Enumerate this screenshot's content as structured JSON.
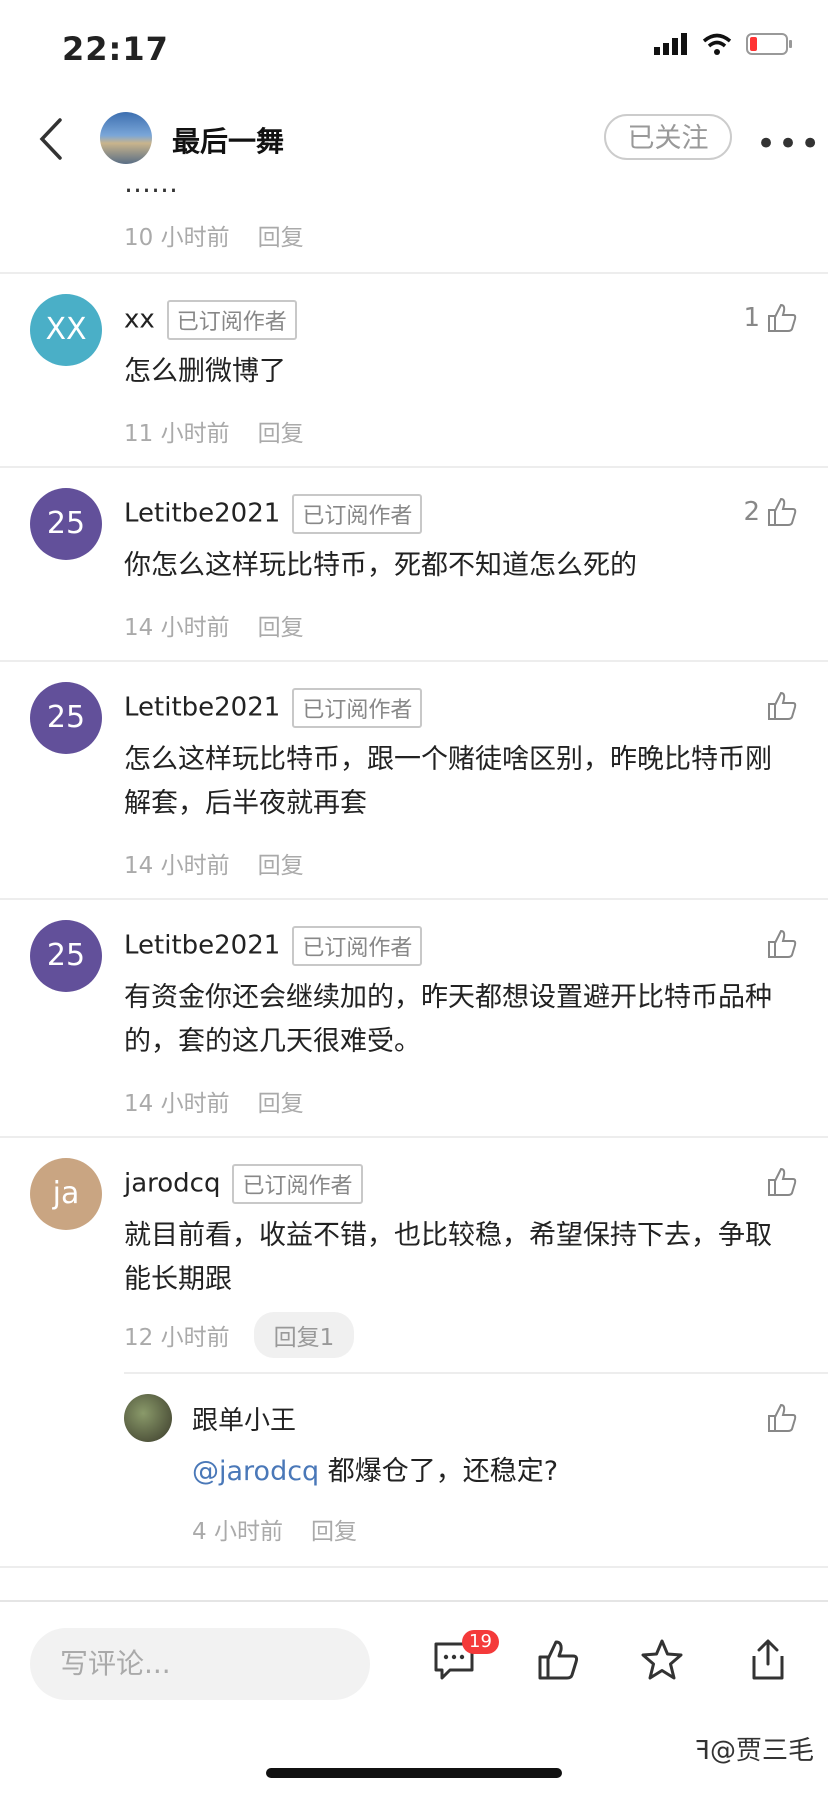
{
  "status": {
    "time": "22:17"
  },
  "nav": {
    "title": "最后一舞",
    "follow_label": "已关注",
    "more": "•••"
  },
  "partial": {
    "time": "10 小时前",
    "reply": "回复"
  },
  "comments": [
    {
      "avatar": "XX",
      "avatar_color": "#4aafc7",
      "name": "xx",
      "badge": "已订阅作者",
      "likes": "1",
      "text": "怎么删微博了",
      "time": "11 小时前",
      "reply": "回复"
    },
    {
      "avatar": "25",
      "avatar_color": "#62509a",
      "name": "Letitbe2021",
      "badge": "已订阅作者",
      "likes": "2",
      "text": "你怎么这样玩比特币，死都不知道怎么死的",
      "time": "14 小时前",
      "reply": "回复"
    },
    {
      "avatar": "25",
      "avatar_color": "#62509a",
      "name": "Letitbe2021",
      "badge": "已订阅作者",
      "text": "怎么这样玩比特币，跟一个赌徒啥区别，昨晚比特币刚解套，后半夜就再套",
      "time": "14 小时前",
      "reply": "回复"
    },
    {
      "avatar": "25",
      "avatar_color": "#62509a",
      "name": "Letitbe2021",
      "badge": "已订阅作者",
      "text": "有资金你还会继续加的，昨天都想设置避开比特币品种的，套的这几天很难受。",
      "time": "14 小时前",
      "reply": "回复"
    },
    {
      "avatar": "ja",
      "avatar_color": "#c9a582",
      "name": "jarodcq",
      "badge": "已订阅作者",
      "text": "就目前看，收益不错，也比较稳，希望保持下去，争取能长期跟",
      "time": "12 小时前",
      "reply": "回复1"
    }
  ],
  "subreply": {
    "name": "跟单小王",
    "mention": "@jarodcq",
    "text": " 都爆仓了，还稳定?",
    "time": "4 小时前",
    "reply": "回复"
  },
  "bottom": {
    "placeholder": "写评论...",
    "comment_count": "19"
  },
  "watermark": "@贾三毛"
}
